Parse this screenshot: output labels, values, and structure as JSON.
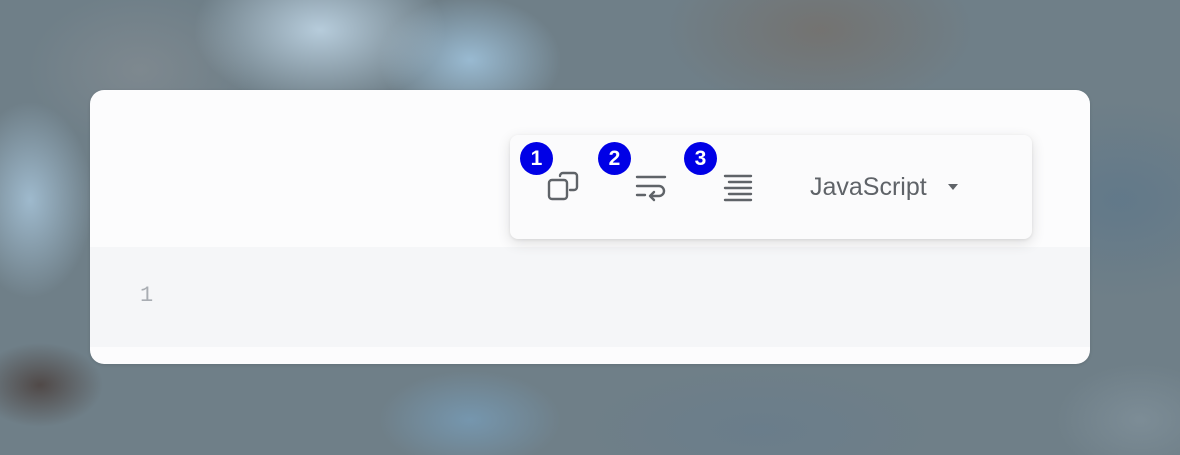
{
  "editor": {
    "line_numbers": [
      "1"
    ]
  },
  "toolbar": {
    "buttons": [
      {
        "badge": "1",
        "icon": "copy-icon"
      },
      {
        "badge": "2",
        "icon": "wrap-lines-icon"
      },
      {
        "badge": "3",
        "icon": "format-align-icon"
      }
    ],
    "language": {
      "selected": "JavaScript",
      "icon": "caret-down-icon"
    }
  },
  "colors": {
    "badge": "#0000e6",
    "icon": "#5f6368",
    "card": "#fcfcfd",
    "code_area": "#f5f6f8"
  }
}
